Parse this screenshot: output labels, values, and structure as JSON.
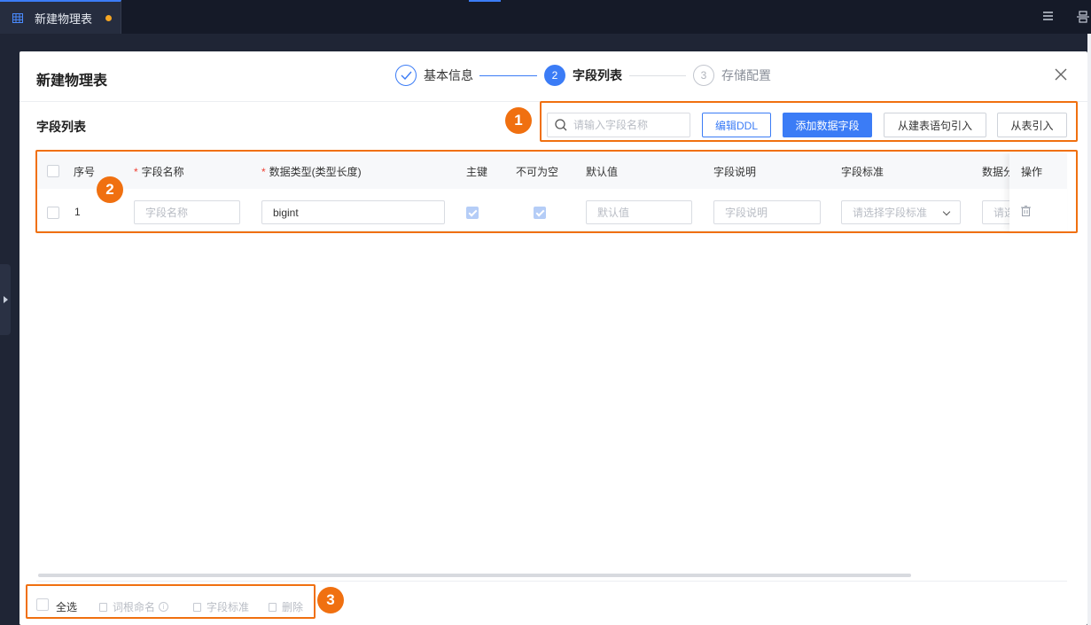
{
  "topbar": {
    "tab_label": "新建物理表"
  },
  "panel": {
    "title": "新建物理表",
    "steps": [
      {
        "num": "",
        "label": "基本信息",
        "state": "done"
      },
      {
        "num": "2",
        "label": "字段列表",
        "state": "active"
      },
      {
        "num": "3",
        "label": "存储配置",
        "state": "todo"
      }
    ],
    "section_title": "字段列表"
  },
  "toolbar": {
    "search_placeholder": "请输入字段名称",
    "edit_ddl": "编辑DDL",
    "add_field": "添加数据字段",
    "import_from_ddl": "从建表语句引入",
    "import_from_table": "从表引入"
  },
  "table": {
    "columns": {
      "index": "序号",
      "field_name": "字段名称",
      "data_type": "数据类型(类型长度)",
      "primary_key": "主键",
      "not_null": "不可为空",
      "default_value": "默认值",
      "field_desc": "字段说明",
      "field_standard": "字段标准",
      "data_class": "数据分",
      "actions": "操作"
    },
    "rows": [
      {
        "index": "1",
        "field_name_placeholder": "字段名称",
        "data_type": "bigint",
        "primary_key": true,
        "not_null": true,
        "default_placeholder": "默认值",
        "desc_placeholder": "字段说明",
        "standard_placeholder": "请选择字段标准",
        "data_class_placeholder": "请选"
      }
    ]
  },
  "footer": {
    "select_all": "全选",
    "root_naming": "词根命名",
    "field_standard": "字段标准",
    "delete": "删除"
  },
  "annotations": [
    "1",
    "2",
    "3"
  ],
  "colors": {
    "primary": "#3b7cf6",
    "annotation": "#f07010",
    "required": "#f04134"
  }
}
